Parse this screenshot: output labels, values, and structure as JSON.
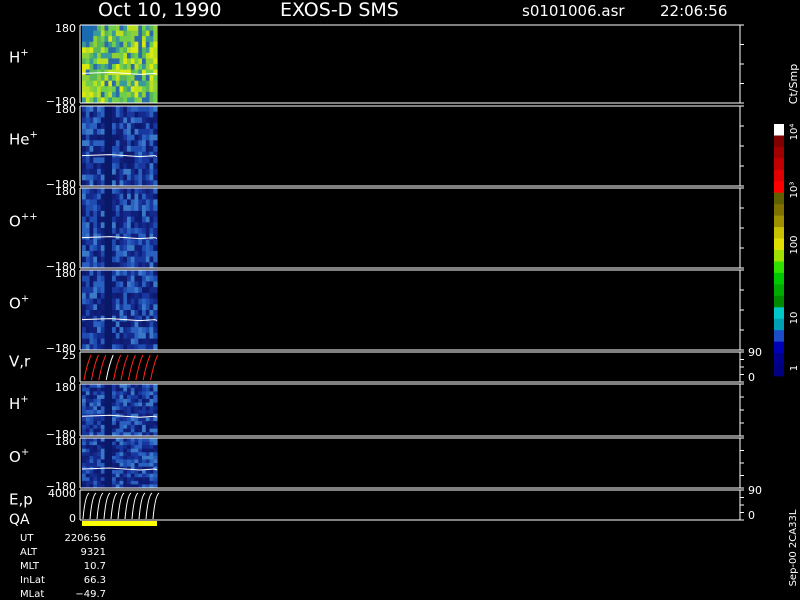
{
  "header": {
    "date": "Oct 10, 1990",
    "instrument": "EXOS-D SMS",
    "file": "s0101006.asr",
    "time": "22:06:56"
  },
  "panels": [
    {
      "id": "h-plus-1",
      "label": "H",
      "sup": "+",
      "ytop": "180",
      "ybot": "−180",
      "palette": "green"
    },
    {
      "id": "he-plus",
      "label": "He",
      "sup": "+",
      "ytop": "180",
      "ybot": "−180",
      "palette": "blue"
    },
    {
      "id": "o-plusplus",
      "label": "O",
      "sup": "++",
      "ytop": "180",
      "ybot": "−180",
      "palette": "blue"
    },
    {
      "id": "o-plus-1",
      "label": "O",
      "sup": "+",
      "ytop": "180",
      "ybot": "−180",
      "palette": "blue"
    },
    {
      "id": "vr",
      "label": "V,r",
      "sup": "",
      "ytop": "25",
      "ybot": "0",
      "rtop": "90",
      "rbot": "0"
    },
    {
      "id": "h-plus-2",
      "label": "H",
      "sup": "+",
      "ytop": "180",
      "ybot": "−180",
      "palette": "blue"
    },
    {
      "id": "o-plus-2",
      "label": "O",
      "sup": "+",
      "ytop": "180",
      "ybot": "−180",
      "palette": "blue"
    },
    {
      "id": "ep",
      "label": "E,p",
      "sup": "",
      "ytop": "4000",
      "ybot": "0",
      "rtop": "90",
      "rbot": "0"
    }
  ],
  "qa_label": "QA",
  "colorbar": {
    "unit": "Ct/Smp",
    "ticks": [
      "1",
      "10",
      "100",
      "10³",
      "10⁴"
    ],
    "colors": [
      "#000080",
      "#00008c",
      "#0000b4",
      "#1c4cc8",
      "#00a0b4",
      "#00c8c8",
      "#008a00",
      "#00aa00",
      "#00c800",
      "#30e000",
      "#a0e000",
      "#e0e000",
      "#c8c000",
      "#a09000",
      "#807000",
      "#606000",
      "#ff0000",
      "#e00000",
      "#c00000",
      "#a00000",
      "#800000",
      "#ffffff"
    ]
  },
  "orbit": {
    "rows": [
      {
        "name": "UT",
        "value": "2206:56"
      },
      {
        "name": "ALT",
        "value": "9321"
      },
      {
        "name": "MLT",
        "value": "10.7"
      },
      {
        "name": "InLat",
        "value": "66.3"
      },
      {
        "name": "MLat",
        "value": "−49.7"
      }
    ]
  },
  "footer_right": "Sep-00 2CA33L",
  "chart_data": {
    "type": "heatmap",
    "title": "Oct 10, 1990   EXOS-D SMS",
    "panels": [
      "H+",
      "He+",
      "O++",
      "O+",
      "V,r",
      "H+",
      "O+",
      "E,p"
    ],
    "yrange_angle": [
      -180,
      180
    ],
    "colorbar_range": [
      1,
      10000
    ],
    "colorbar_scale": "log",
    "colorbar_unit": "Ct/Smp"
  }
}
